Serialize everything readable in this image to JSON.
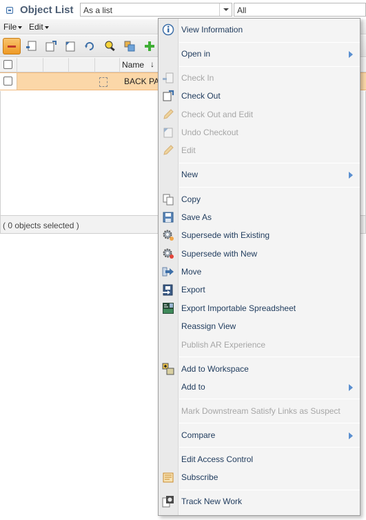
{
  "panel": {
    "title": "Object List",
    "view_select": "As a list",
    "filter_select": "All",
    "menus": [
      {
        "label": "File"
      },
      {
        "label": "Edit"
      }
    ],
    "grid": {
      "name_header": "Name",
      "sort_indicator": "↓",
      "rows": [
        {
          "name": "BACK PA"
        }
      ]
    },
    "status": "( 0 objects selected )"
  },
  "context_menu": {
    "items": [
      {
        "label": "View Information",
        "icon": "info-icon",
        "disabled": false
      },
      {
        "label": "Open in",
        "submenu": true,
        "disabled": false
      },
      {
        "label": "Check In",
        "icon": "check-in-icon",
        "disabled": true
      },
      {
        "label": "Check Out",
        "icon": "check-out-icon",
        "disabled": false
      },
      {
        "label": "Check Out and Edit",
        "icon": "pencil-icon",
        "disabled": true
      },
      {
        "label": "Undo Checkout",
        "icon": "undo-checkout-icon",
        "disabled": true
      },
      {
        "label": "Edit",
        "icon": "pencil-icon",
        "disabled": true
      },
      {
        "label": "New",
        "submenu": true,
        "disabled": false
      },
      {
        "label": "Copy",
        "icon": "copy-icon",
        "disabled": false
      },
      {
        "label": "Save As",
        "icon": "save-as-icon",
        "disabled": false
      },
      {
        "label": "Supersede with Existing",
        "icon": "gear-icon",
        "disabled": false
      },
      {
        "label": "Supersede with New",
        "icon": "gear-new-icon",
        "disabled": false
      },
      {
        "label": "Move",
        "icon": "move-arrow-icon",
        "disabled": false
      },
      {
        "label": "Export",
        "icon": "export-icon",
        "disabled": false
      },
      {
        "label": "Export Importable Spreadsheet",
        "icon": "spreadsheet-icon",
        "disabled": false
      },
      {
        "label": "Reassign View",
        "disabled": false
      },
      {
        "label": "Publish AR Experience",
        "disabled": true
      },
      {
        "label": "Add to Workspace",
        "icon": "add-workspace-icon",
        "disabled": false
      },
      {
        "label": "Add to",
        "submenu": true,
        "disabled": false
      },
      {
        "label": "Mark Downstream Satisfy Links as Suspect",
        "disabled": true
      },
      {
        "label": "Compare",
        "submenu": true,
        "disabled": false
      },
      {
        "label": "Edit Access Control",
        "disabled": false
      },
      {
        "label": "Subscribe",
        "icon": "subscribe-icon",
        "disabled": false
      },
      {
        "label": "Track New Work",
        "icon": "track-work-icon",
        "disabled": false
      }
    ]
  },
  "colors": {
    "selected_row": "#fbd7a8",
    "menu_text": "#1e3a5c",
    "disabled_text": "#a6a6a6",
    "submenu_arrow": "#5a8fd0"
  }
}
